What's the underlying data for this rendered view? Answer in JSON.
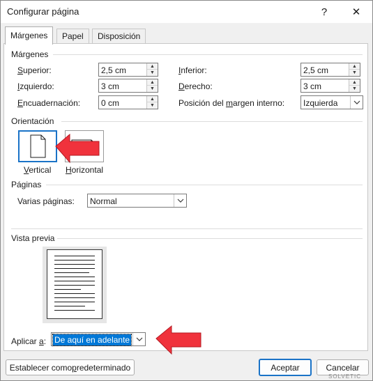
{
  "window": {
    "title": "Configurar página",
    "help_icon": "?",
    "close_icon": "✕"
  },
  "tabs": [
    {
      "label": "Márgenes",
      "active": true
    },
    {
      "label": "Papel",
      "active": false
    },
    {
      "label": "Disposición",
      "active": false
    }
  ],
  "margins": {
    "group_label": "Márgenes",
    "top_label_u": "S",
    "top_label_rest": "uperior:",
    "top_value": "2,5 cm",
    "bottom_label_u": "I",
    "bottom_label_rest": "nferior:",
    "bottom_value": "2,5 cm",
    "left_label_u": "I",
    "left_label_rest": "zquierdo:",
    "left_value": "3 cm",
    "right_label_u": "D",
    "right_label_rest": "erecho:",
    "right_value": "3 cm",
    "gutter_label_u": "E",
    "gutter_label_rest": "ncuadernación:",
    "gutter_value": "0 cm",
    "gutter_pos_label_pre": "Posición del ",
    "gutter_pos_label_u": "m",
    "gutter_pos_label_rest": "argen interno:",
    "gutter_pos_value": "Izquierda"
  },
  "orientation": {
    "group_label": "Orientación",
    "portrait_label_u": "V",
    "portrait_label_rest": "ertical",
    "landscape_label_u": "H",
    "landscape_label_rest": "orizontal",
    "selected": "portrait"
  },
  "pages": {
    "group_label": "Páginas",
    "multiple_label_pre": "Varias pá",
    "multiple_label_u": "g",
    "multiple_label_rest": "inas:",
    "multiple_value": "Normal"
  },
  "preview": {
    "group_label": "Vista previa"
  },
  "apply": {
    "label_pre": "Aplicar ",
    "label_u": "a",
    "label_rest": ":",
    "value": "De aquí en adelante"
  },
  "footer": {
    "set_default_pre": "Establecer como ",
    "set_default_u": "p",
    "set_default_rest": "redeterminado",
    "ok_label": "Aceptar",
    "cancel_label": "Cancelar"
  },
  "watermark": "SOLVETIC",
  "colors": {
    "accent": "#1a73c7",
    "annotation_arrow": "#f0323c",
    "selection_bg": "#0078d7"
  }
}
